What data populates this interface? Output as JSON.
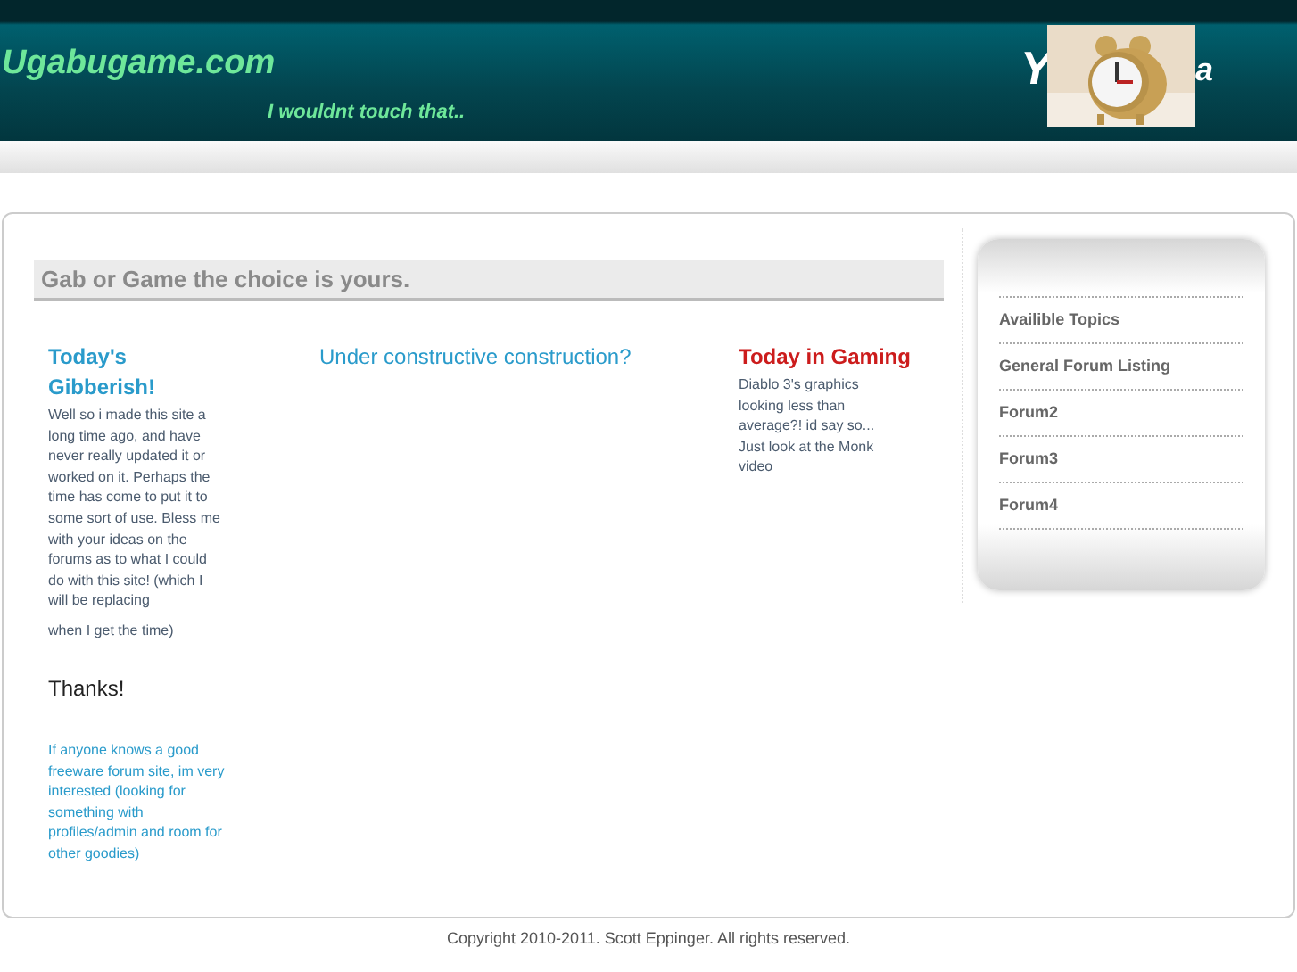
{
  "header": {
    "site_title": "Ugabugame.com",
    "tagline": "I wouldnt touch that..",
    "banner_left": "Y",
    "banner_right": "a"
  },
  "section_title": "Gab or Game the choice is yours.",
  "left_column": {
    "heading": "Today's Gibberish!",
    "body": "Well so i made this site a long time ago, and have never really updated it or worked on it. Perhaps the time has come to put it to some sort of use. Bless me with your ideas on the forums as to what I could do with this site! (which I will be replacing",
    "body_end": "when I get the time)",
    "thanks": "Thanks!",
    "note": "If anyone knows a good freeware forum site, im very interested (looking for something with profiles/admin and room for",
    "note_end": "other goodies)"
  },
  "middle_column": {
    "heading": "Under constructive construction?"
  },
  "right_column": {
    "heading": "Today in Gaming",
    "body": "Diablo 3's graphics looking less than average?! id say so... Just look at the Monk video"
  },
  "sidebar": {
    "items": [
      {
        "label": "Availible Topics"
      },
      {
        "label": "General Forum Listing"
      },
      {
        "label": "Forum2"
      },
      {
        "label": "Forum3"
      },
      {
        "label": "Forum4"
      }
    ]
  },
  "footer": "Copyright 2010-2011. Scott Eppinger. All rights reserved."
}
